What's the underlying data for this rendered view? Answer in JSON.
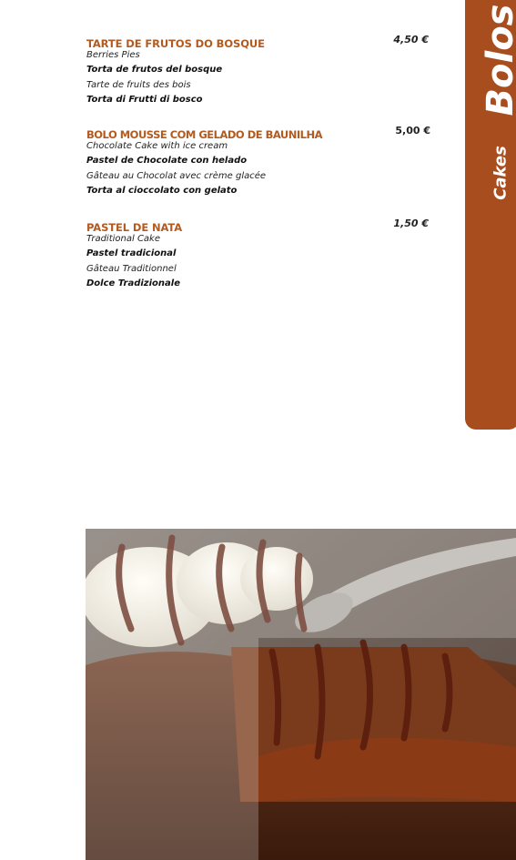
{
  "side_tab": {
    "title": "Bolos",
    "subtitle": "Cakes"
  },
  "items": [
    {
      "title": "TARTE DE FRUTOS DO BOSQUE",
      "price": "4,50 €",
      "translations": [
        {
          "text": "Berries Pies",
          "bold": false
        },
        {
          "text": "Torta de frutos del bosque",
          "bold": true
        },
        {
          "text": "Tarte de fruits des bois",
          "bold": false
        },
        {
          "text": "Torta di Frutti di bosco",
          "bold": true
        }
      ]
    },
    {
      "title": "BOLO MOUSSE COM GELADO DE BAUNILHA",
      "price": "5,00 €",
      "translations": [
        {
          "text": "Chocolate Cake with ice cream",
          "bold": false
        },
        {
          "text": "Pastel de Chocolate con helado",
          "bold": true
        },
        {
          "text": "Gâteau au Chocolat avec crème glacée",
          "bold": false
        },
        {
          "text": "Torta al cioccolato con gelato",
          "bold": true
        }
      ]
    },
    {
      "title": "PASTEL DE NATA",
      "price": "1,50 €",
      "translations": [
        {
          "text": "Traditional Cake",
          "bold": false
        },
        {
          "text": "Pastel tradicional",
          "bold": true
        },
        {
          "text": "Gâteau Traditionnel",
          "bold": false
        },
        {
          "text": "Dolce Tradizionale",
          "bold": true
        }
      ]
    }
  ],
  "colors": {
    "accent": "#a84e1e",
    "title": "#b35a1f"
  }
}
